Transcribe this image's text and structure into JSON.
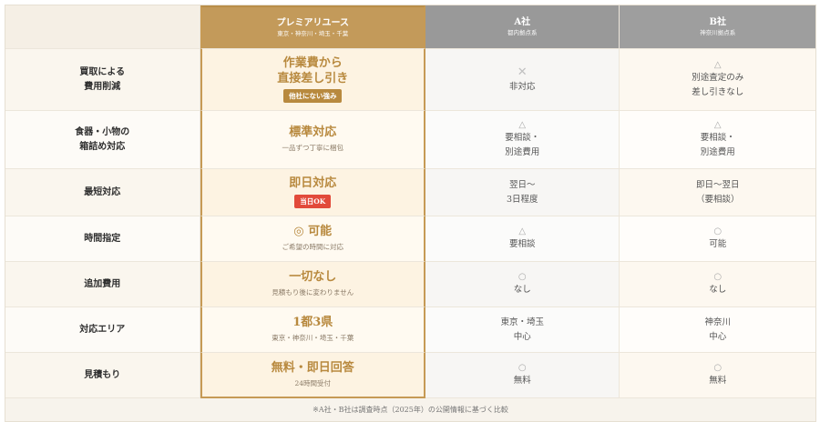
{
  "header": {
    "premium": {
      "title": "プレミアリユース",
      "sub": "東京・神奈川・埼玉・千葉"
    },
    "a": {
      "title": "A社",
      "sub": "都内拠点系"
    },
    "b": {
      "title": "B社",
      "sub": "神奈川拠点系"
    }
  },
  "rows": [
    {
      "label_lines": [
        "買取による",
        "費用削減"
      ],
      "premium": {
        "main_lines": [
          "作業費から",
          "直接差し引き"
        ],
        "sub": "",
        "badge": "他社にない強み",
        "badge_style": "gold"
      },
      "a": {
        "mark": "✕",
        "text_lines": [
          "非対応"
        ]
      },
      "b": {
        "mark": "△",
        "text_lines": [
          "別途査定のみ",
          "差し引きなし"
        ]
      }
    },
    {
      "label_lines": [
        "食器・小物の",
        "箱詰め対応"
      ],
      "premium": {
        "main_lines": [
          "標準対応"
        ],
        "sub": "一品ずつ丁寧に梱包",
        "badge": "",
        "badge_style": ""
      },
      "a": {
        "mark": "△",
        "text_lines": [
          "要相談・",
          "別途費用"
        ]
      },
      "b": {
        "mark": "△",
        "text_lines": [
          "要相談・",
          "別途費用"
        ]
      }
    },
    {
      "label_lines": [
        "最短対応"
      ],
      "premium": {
        "main_lines": [
          "即日対応"
        ],
        "sub": "",
        "badge": "当日OK",
        "badge_style": "red"
      },
      "a": {
        "mark": "",
        "text_lines": [
          "翌日〜",
          "3日程度"
        ]
      },
      "b": {
        "mark": "",
        "text_lines": [
          "即日〜翌日",
          "（要相談）"
        ]
      }
    },
    {
      "label_lines": [
        "時間指定"
      ],
      "premium": {
        "main_lines": [
          "◎ 可能"
        ],
        "sub": "ご希望の時間に対応",
        "badge": "",
        "badge_style": ""
      },
      "a": {
        "mark": "△",
        "text_lines": [
          "要相談"
        ]
      },
      "b": {
        "mark": "○",
        "text_lines": [
          "可能"
        ]
      }
    },
    {
      "label_lines": [
        "追加費用"
      ],
      "premium": {
        "main_lines": [
          "一切なし"
        ],
        "sub": "見積もり後に変わりません",
        "badge": "",
        "badge_style": ""
      },
      "a": {
        "mark": "○",
        "text_lines": [
          "なし"
        ]
      },
      "b": {
        "mark": "○",
        "text_lines": [
          "なし"
        ]
      }
    },
    {
      "label_lines": [
        "対応エリア"
      ],
      "premium": {
        "main_lines": [
          "1都3県"
        ],
        "sub": "東京・神奈川・埼玉・千葉",
        "badge": "",
        "badge_style": ""
      },
      "a": {
        "mark": "",
        "text_lines": [
          "東京・埼玉",
          "中心"
        ]
      },
      "b": {
        "mark": "",
        "text_lines": [
          "神奈川",
          "中心"
        ]
      }
    },
    {
      "label_lines": [
        "見積もり"
      ],
      "premium": {
        "main_lines": [
          "無料・即日回答"
        ],
        "sub": "24時間受付",
        "badge": "",
        "badge_style": ""
      },
      "a": {
        "mark": "○",
        "text_lines": [
          "無料"
        ]
      },
      "b": {
        "mark": "○",
        "text_lines": [
          "無料"
        ]
      }
    }
  ],
  "footnote": "※A社・B社は調査時点（2025年）の公開情報に基づく比較"
}
